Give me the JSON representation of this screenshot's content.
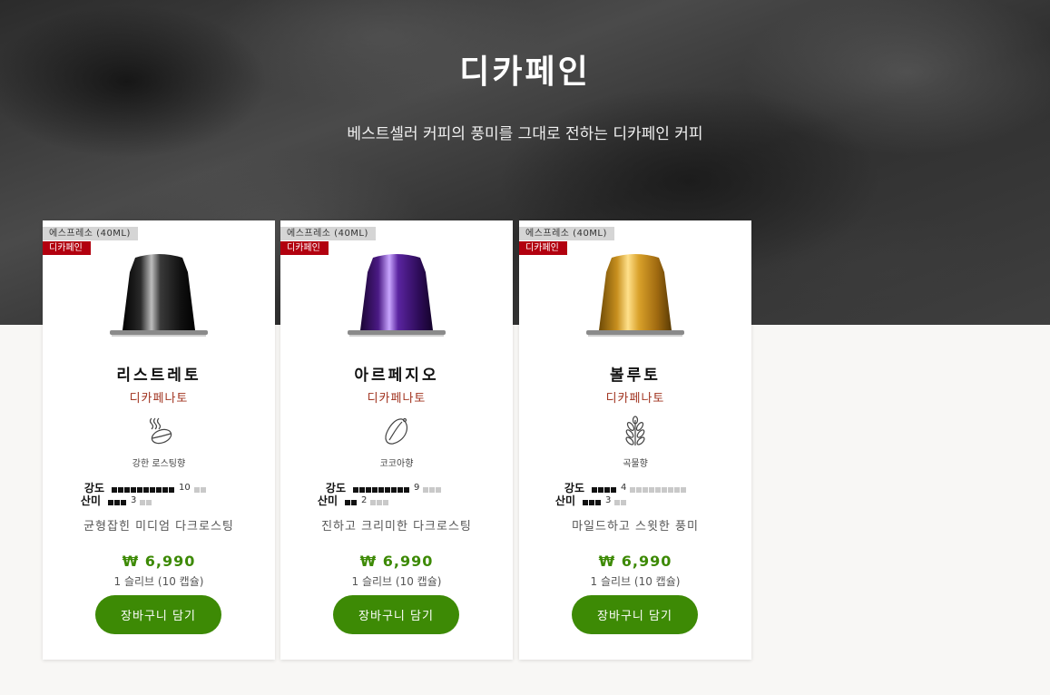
{
  "hero": {
    "title": "디카페인",
    "subtitle": "베스트셀러 커피의 풍미를 그대로 전하는 디카페인 커피"
  },
  "labels": {
    "intensity": "강도",
    "acidity": "산미"
  },
  "products": [
    {
      "cup_size": "에스프레소 (40ML)",
      "badge": "디카페인",
      "name": "리스트레토",
      "origin": "디카페나토",
      "aroma_icon": "roasted-bean-icon",
      "aroma": "강한 로스팅향",
      "intensity": 10,
      "intensity_max": 12,
      "intensity_text": "10",
      "acidity": 3,
      "acidity_max": 5,
      "acidity_text": "3",
      "description": "균형잡힌 미디엄 다크로스팅",
      "price": "₩ 6,990",
      "unit": "1 슬리브 (10 캡슐)",
      "cta": "장바구니 담기",
      "capsule_color": "#1a1a1a"
    },
    {
      "cup_size": "에스프레소 (40ML)",
      "badge": "디카페인",
      "name": "아르페지오",
      "origin": "디카페나토",
      "aroma_icon": "cocoa-pod-icon",
      "aroma": "코코아향",
      "intensity": 9,
      "intensity_max": 12,
      "intensity_text": "9",
      "acidity": 2,
      "acidity_max": 5,
      "acidity_text": "2",
      "description": "진하고 크리미한 다크로스팅",
      "price": "₩ 6,990",
      "unit": "1 슬리브 (10 캡슐)",
      "cta": "장바구니 담기",
      "capsule_color": "#4a1d7a"
    },
    {
      "cup_size": "에스프레소 (40ML)",
      "badge": "디카페인",
      "name": "볼루토",
      "origin": "디카페나토",
      "aroma_icon": "grain-icon",
      "aroma": "곡물향",
      "intensity": 4,
      "intensity_max": 13,
      "intensity_text": "4",
      "acidity": 3,
      "acidity_max": 5,
      "acidity_text": "3",
      "description": "마일드하고 스윗한 풍미",
      "price": "₩ 6,990",
      "unit": "1 슬리브 (10 캡슐)",
      "cta": "장바구니 담기",
      "capsule_color": "#c8901f"
    }
  ],
  "colors": {
    "accent_green": "#3d8a05",
    "badge_red": "#b2000f",
    "origin_red": "#a0321e"
  }
}
